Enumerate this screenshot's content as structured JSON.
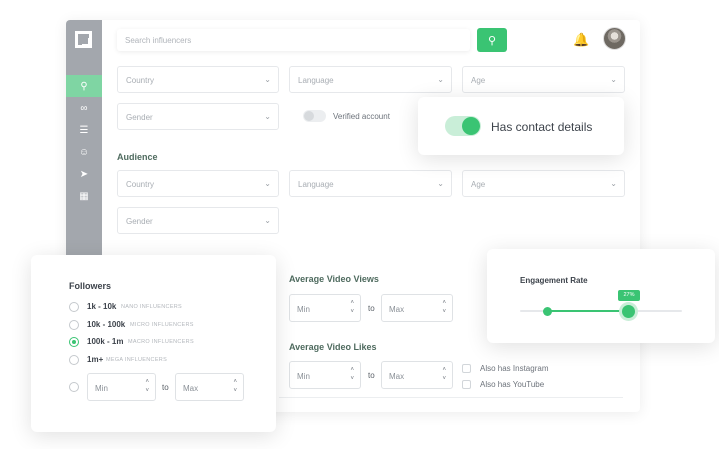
{
  "search": {
    "placeholder": "Search influencers"
  },
  "filters": {
    "country": "Country",
    "language": "Language",
    "age": "Age",
    "gender": "Gender",
    "verified_label": "Verified account",
    "contact_label": "Has contact details"
  },
  "audience": {
    "title": "Audience",
    "country": "Country",
    "language": "Language",
    "age": "Age",
    "gender": "Gender"
  },
  "followers": {
    "title": "Followers",
    "options": [
      {
        "range": "1k - 10k",
        "tier": "NANO INFLUENCERS",
        "checked": false
      },
      {
        "range": "10k - 100k",
        "tier": "MICRO INFLUENCERS",
        "checked": false
      },
      {
        "range": "100k - 1m",
        "tier": "MACRO INFLUENCERS",
        "checked": true
      },
      {
        "range": "1m+",
        "tier": "MEGA INFLUENCERS",
        "checked": false
      }
    ],
    "min_placeholder": "Min",
    "to_label": "to",
    "max_placeholder": "Max"
  },
  "video_views": {
    "title": "Average Video Views",
    "min": "Min",
    "to": "to",
    "max": "Max"
  },
  "video_likes": {
    "title": "Average Video Likes",
    "min": "Min",
    "to": "to",
    "max": "Max"
  },
  "also_has": {
    "instagram": "Also has Instagram",
    "youtube": "Also has YouTube"
  },
  "engagement": {
    "title": "Engagement Rate",
    "value_label": "27%",
    "low_fraction": 0.17,
    "high_fraction": 0.67
  },
  "colors": {
    "accent": "#3ac473",
    "sidebar": "#a3a7ad",
    "active_nav": "#7fd5a3"
  }
}
